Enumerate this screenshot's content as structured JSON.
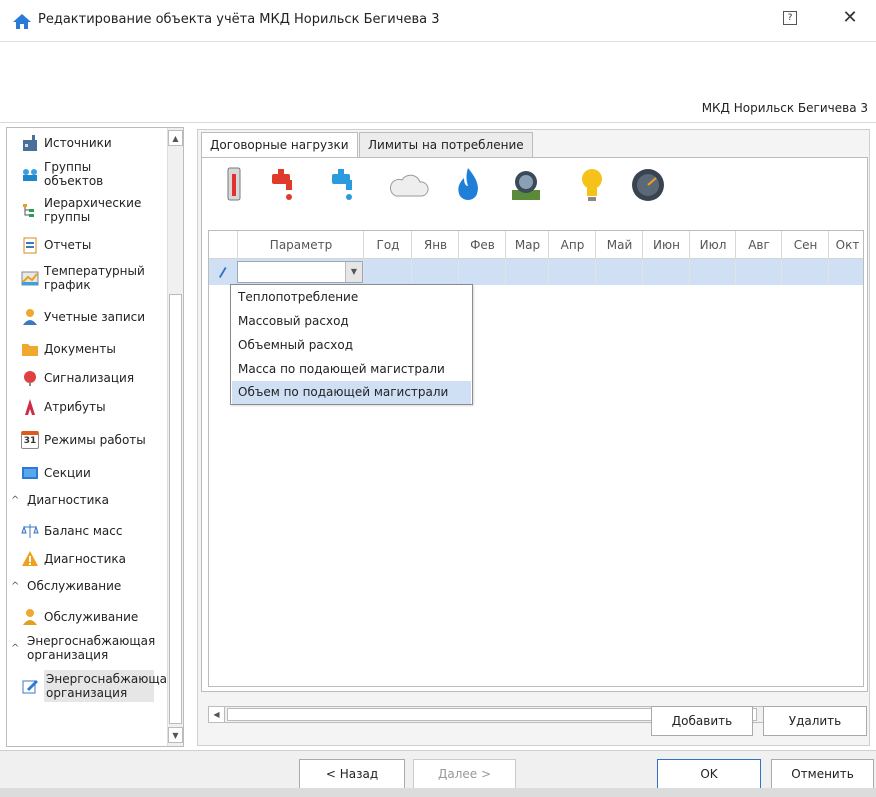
{
  "window": {
    "title": "Редактирование объекта учёта МКД Норильск Бегичева 3",
    "help_glyph": "?",
    "close_glyph": "✕"
  },
  "header": {
    "object_name": "МКД Норильск Бегичева 3"
  },
  "sidebar": {
    "items": [
      {
        "label": "Источники",
        "icon": "factory-icon"
      },
      {
        "label": "Группы объектов",
        "icon": "group-objects-icon"
      },
      {
        "label": "Иерархические группы",
        "icon": "hierarchy-icon"
      },
      {
        "label": "Отчеты",
        "icon": "report-icon"
      },
      {
        "label": "Температурный график",
        "icon": "temperature-chart-icon"
      },
      {
        "label": "Учетные записи",
        "icon": "user-icon"
      },
      {
        "label": "Документы",
        "icon": "folder-icon"
      },
      {
        "label": "Сигнализация",
        "icon": "alarm-icon"
      },
      {
        "label": "Атрибуты",
        "icon": "attributes-icon"
      },
      {
        "label": "Режимы работы",
        "icon": "calendar-icon",
        "calendar_day": "31"
      },
      {
        "label": "Секции",
        "icon": "sections-icon"
      }
    ],
    "groups": [
      {
        "label": "Диагностика",
        "chevron": "^",
        "items": [
          {
            "label": "Баланс масс",
            "icon": "scales-icon"
          },
          {
            "label": "Диагностика",
            "icon": "warning-icon"
          }
        ]
      },
      {
        "label": "Обслуживание",
        "chevron": "^",
        "items": [
          {
            "label": "Обслуживание",
            "icon": "service-user-icon"
          }
        ]
      },
      {
        "label": "Энергоснабжающая организация",
        "chevron": "^",
        "items": [
          {
            "label": "Энергоснабжающая организация",
            "icon": "edit-doc-icon",
            "selected": true
          }
        ]
      }
    ]
  },
  "tabs": [
    {
      "label": "Договорные нагрузки",
      "active": true
    },
    {
      "label": "Лимиты на потребление",
      "active": false
    }
  ],
  "resource_icons": [
    "thermometer-icon",
    "hot-water-tap-icon",
    "cold-water-tap-icon",
    "cloud-icon",
    "gas-flame-icon",
    "steam-icon",
    "lightbulb-icon",
    "gauge-icon"
  ],
  "grid": {
    "columns": [
      "Параметр",
      "Год",
      "Янв",
      "Фев",
      "Мар",
      "Апр",
      "Май",
      "Июн",
      "Июл",
      "Авг",
      "Сен",
      "Окт"
    ],
    "editing_row": {
      "parameter": ""
    }
  },
  "dropdown": {
    "options": [
      "Теплопотребление",
      "Массовый расход",
      "Объемный расход",
      "Масса по подающей магистрали",
      "Объем по подающей магистрали"
    ],
    "highlighted_index": 4
  },
  "panel_buttons": {
    "add": "Добавить",
    "delete": "Удалить"
  },
  "footer": {
    "back": "< Назад",
    "next": "Далее >",
    "ok": "OK",
    "cancel": "Отменить"
  },
  "colors": {
    "selection": "#cfe0f4",
    "accent": "#2f72c8"
  }
}
